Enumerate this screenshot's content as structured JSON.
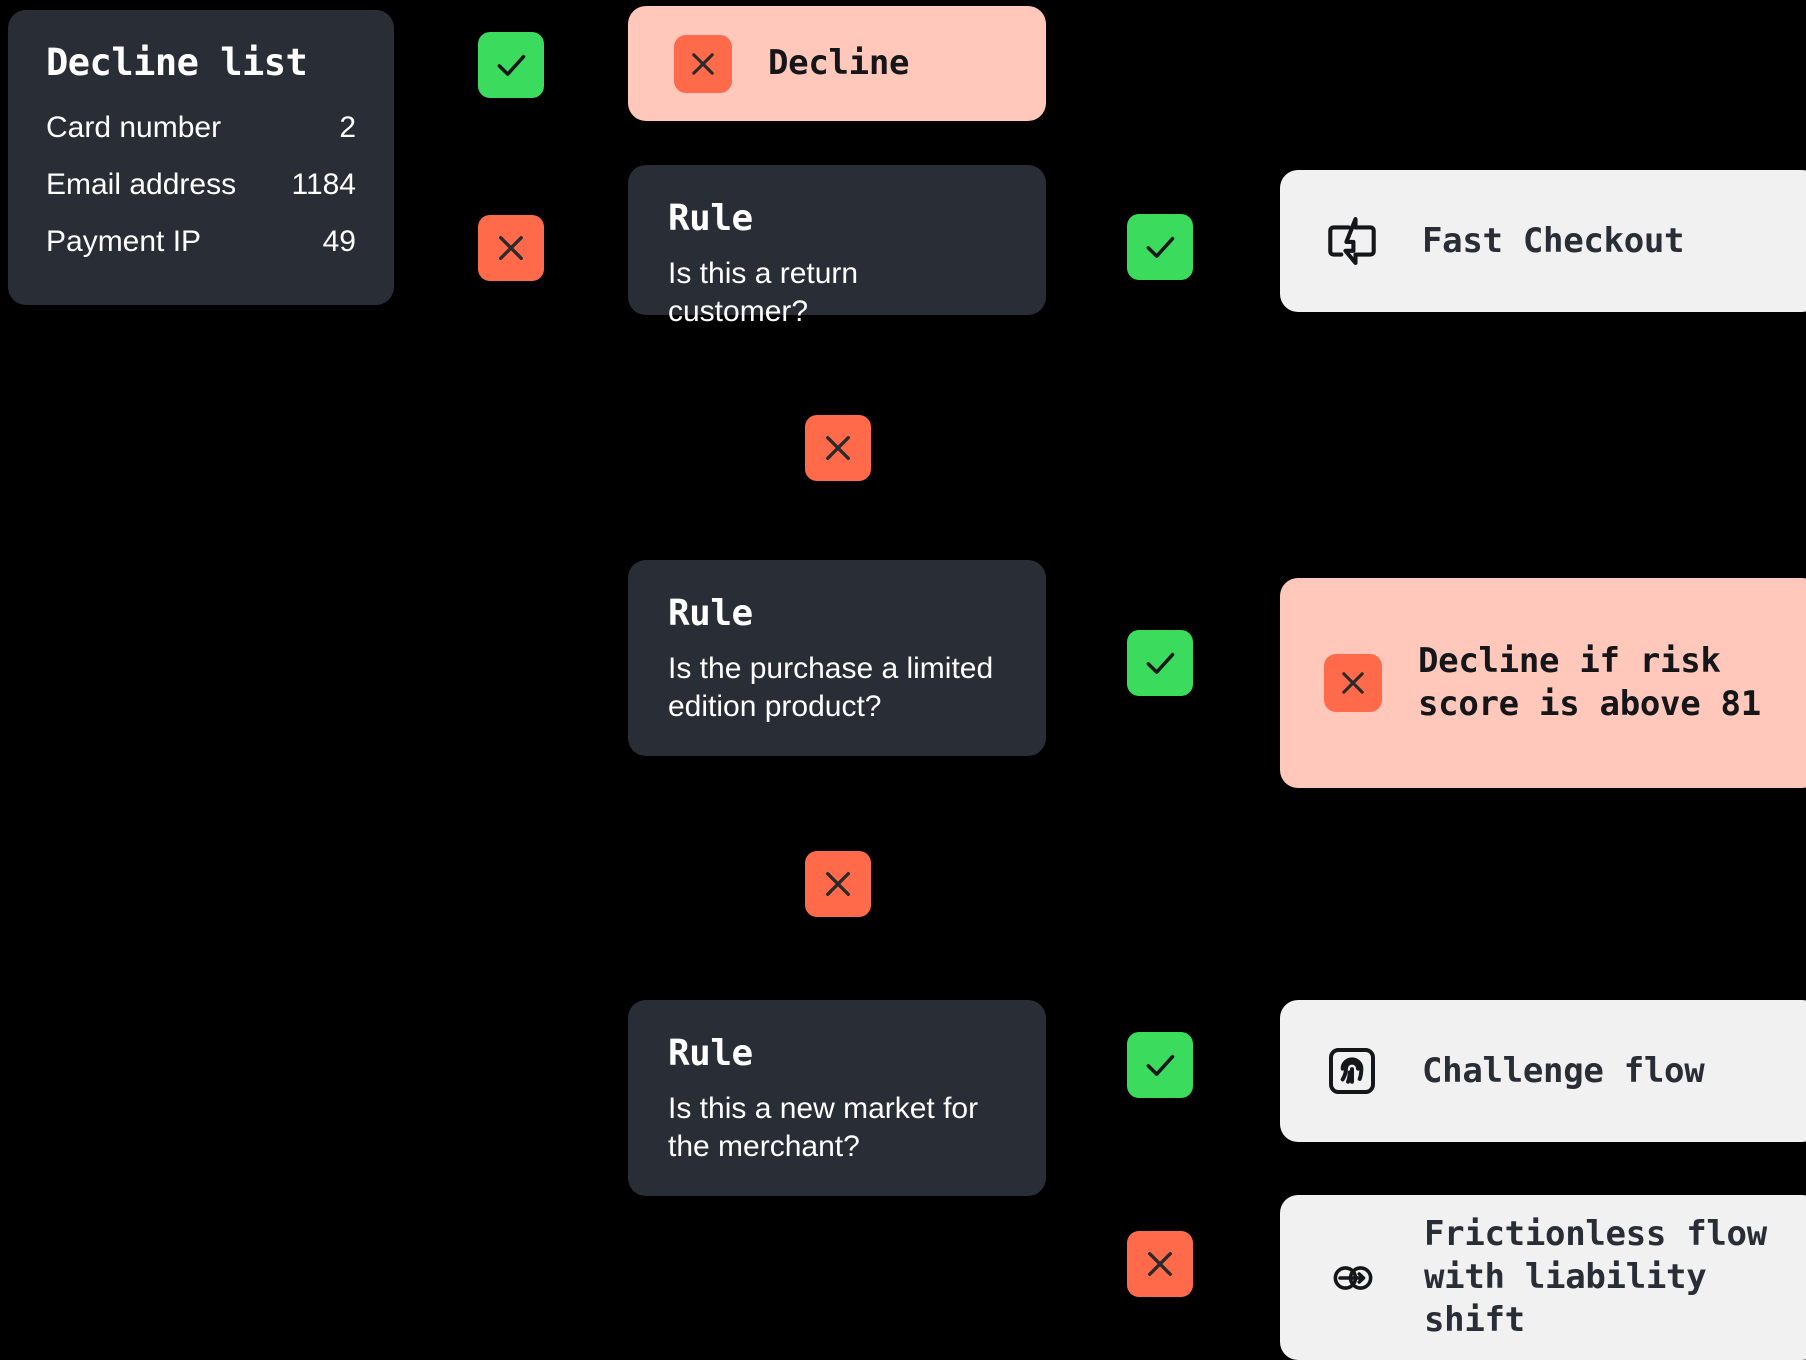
{
  "theme": {
    "background": "#000000",
    "card_dark": "#282D36",
    "card_pink": "#FFC8BB",
    "card_white": "#F2F1F1",
    "accent_green": "#3BDB5E",
    "accent_orange": "#FF6B4A",
    "text_light": "#FFFFFF",
    "text_dark": "#14161A"
  },
  "decline_list": {
    "title": "Decline list",
    "rows": [
      {
        "label": "Card number",
        "value": "2"
      },
      {
        "label": "Email address",
        "value": "1184"
      },
      {
        "label": "Payment IP",
        "value": "49"
      }
    ]
  },
  "rules": [
    {
      "title": "Rule",
      "question": "Is this a return customer?"
    },
    {
      "title": "Rule",
      "question": "Is the purchase a limited edition product?"
    },
    {
      "title": "Rule",
      "question": "Is this a new market for the merchant?"
    }
  ],
  "outcomes": [
    {
      "label": "Decline",
      "icon": "x-icon"
    },
    {
      "label": "Fast Checkout",
      "icon": "lightning-bolt-icon"
    },
    {
      "label": "Decline if risk\nscore is above 81",
      "icon": "x-icon"
    },
    {
      "label": "Challenge flow",
      "icon": "fingerprint-icon"
    },
    {
      "label": "Frictionless flow\nwith liability shift",
      "icon": "linked-circles-arrow-icon"
    }
  ],
  "connectors": [
    {
      "result": "yes",
      "icon": "check-icon"
    },
    {
      "result": "no",
      "icon": "x-icon"
    },
    {
      "result": "yes",
      "icon": "check-icon"
    },
    {
      "result": "no",
      "icon": "x-icon"
    },
    {
      "result": "yes",
      "icon": "check-icon"
    },
    {
      "result": "no",
      "icon": "x-icon"
    },
    {
      "result": "yes",
      "icon": "check-icon"
    },
    {
      "result": "no",
      "icon": "x-icon"
    }
  ]
}
